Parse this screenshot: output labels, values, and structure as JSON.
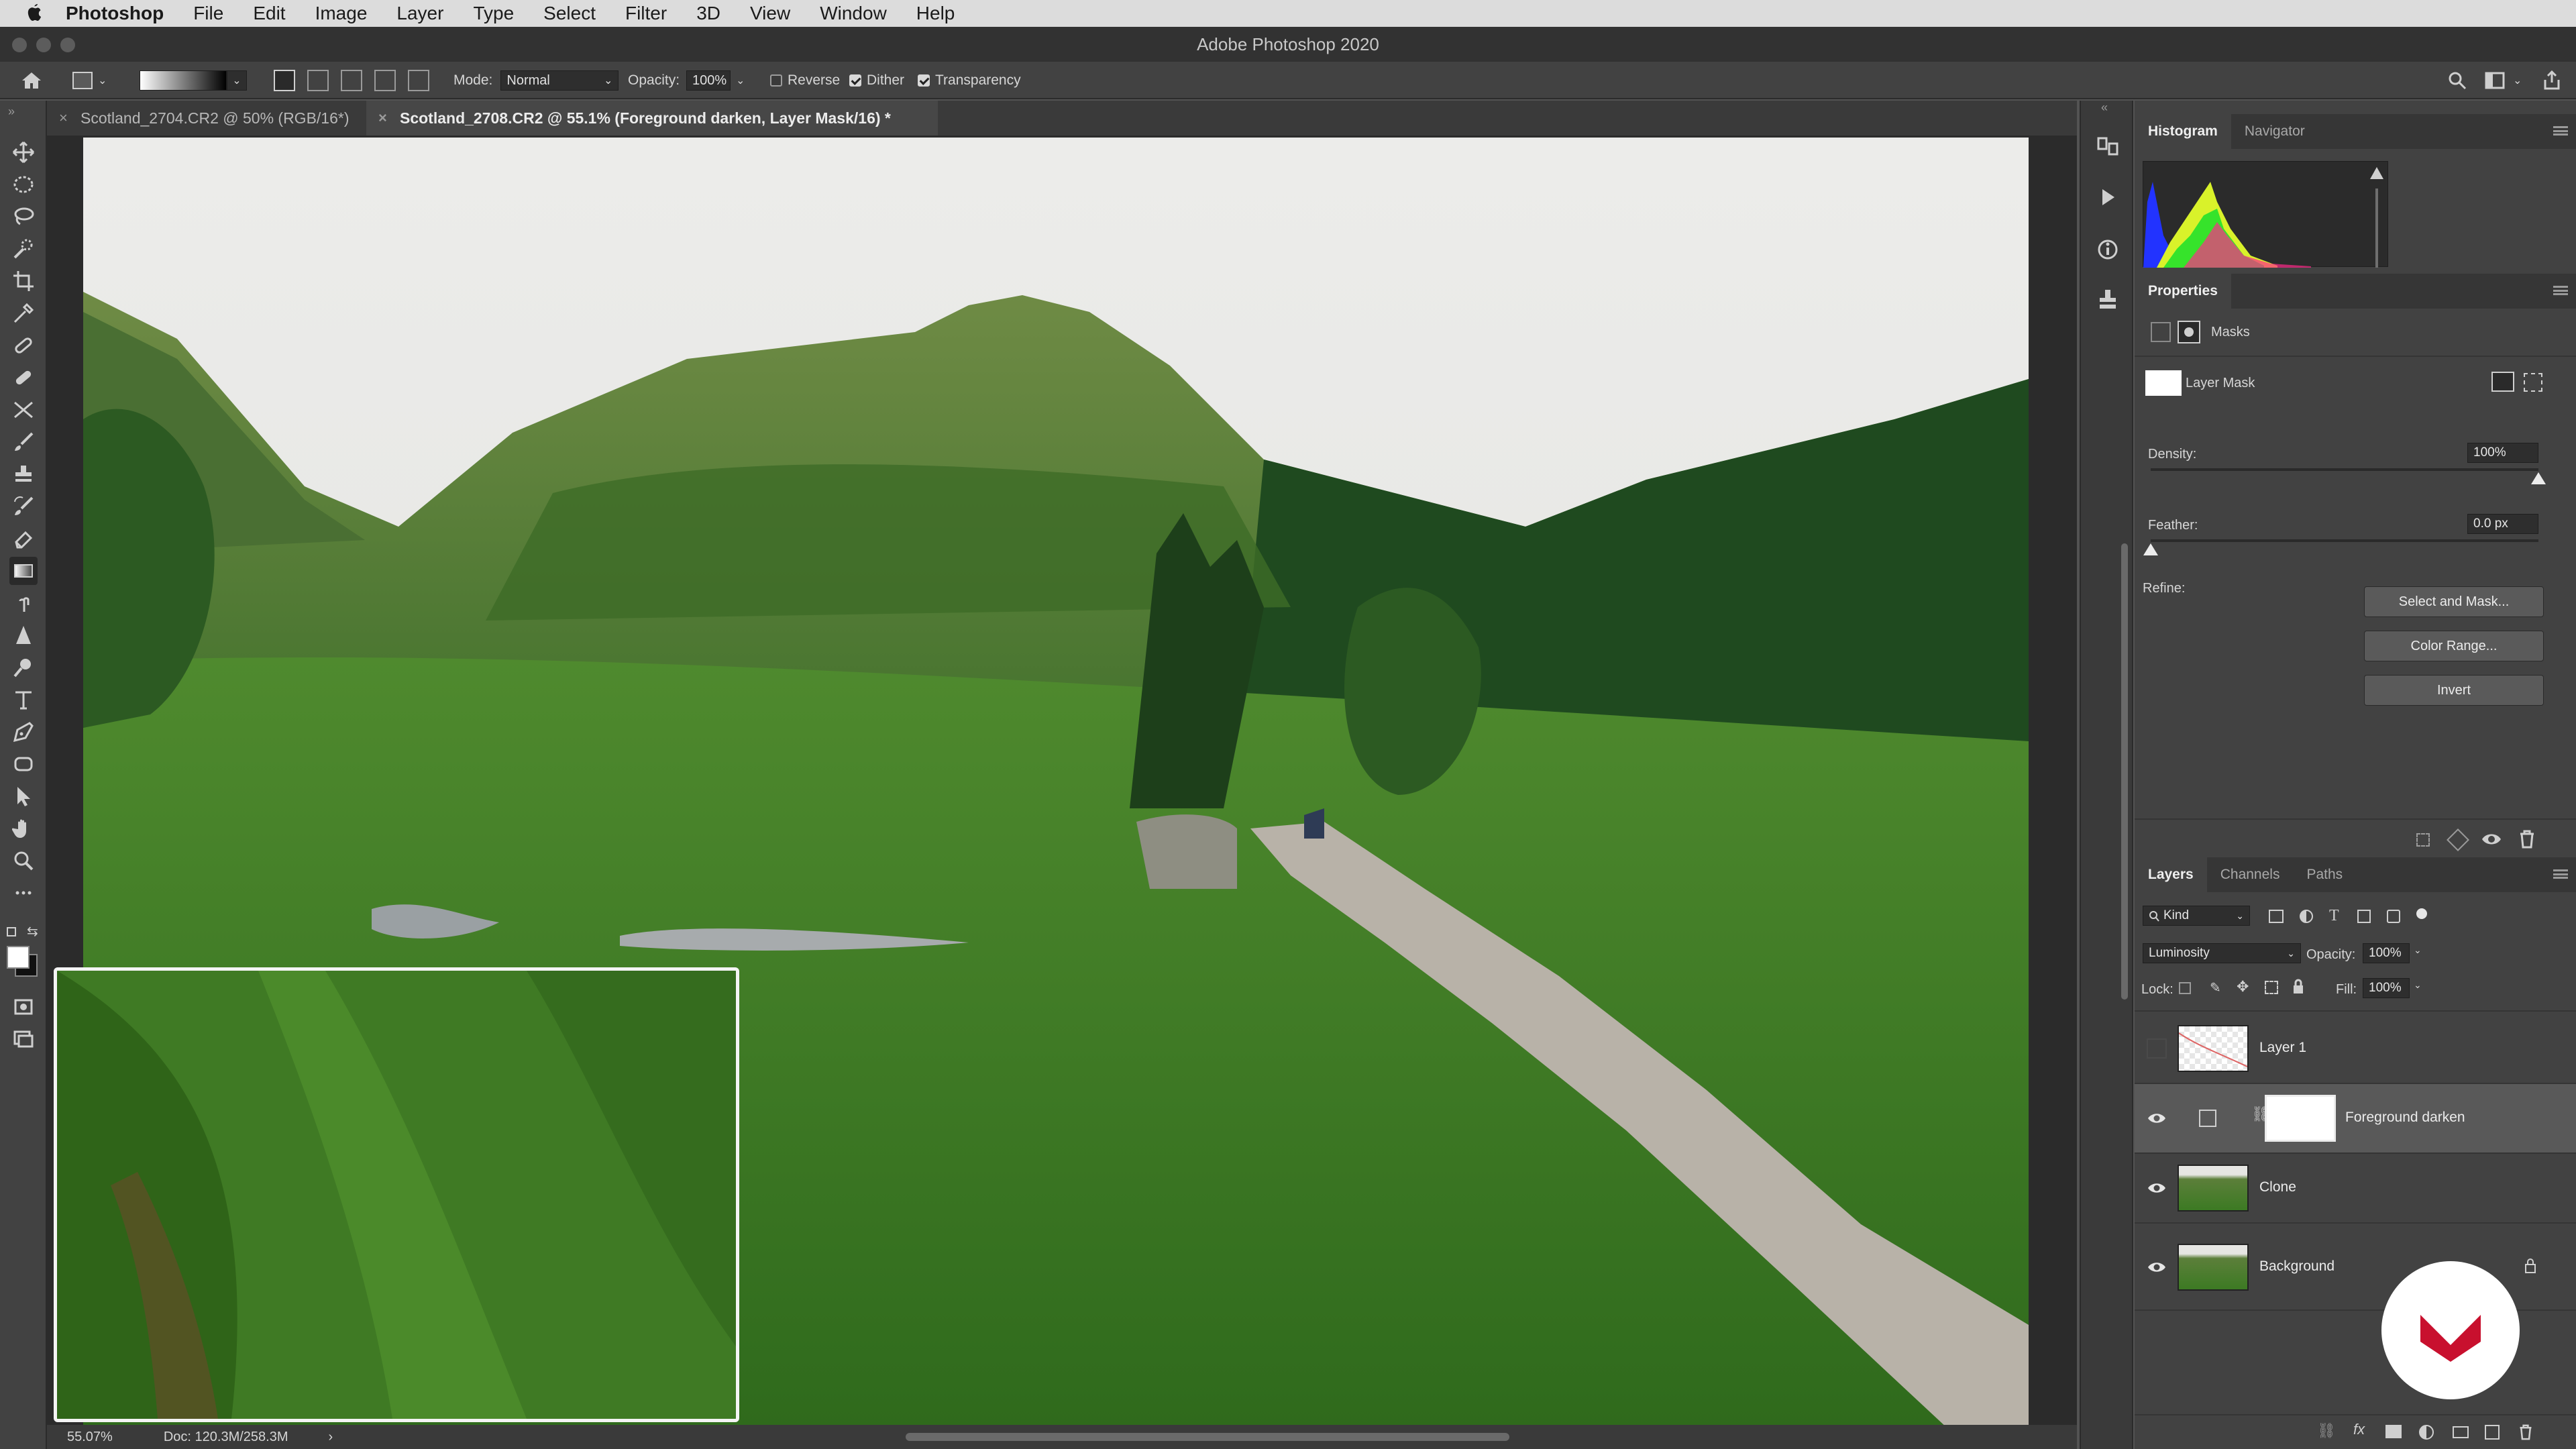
{
  "menubar": {
    "app_name": "Photoshop",
    "items": [
      "File",
      "Edit",
      "Image",
      "Layer",
      "Type",
      "Select",
      "Filter",
      "3D",
      "View",
      "Window",
      "Help"
    ]
  },
  "window": {
    "title": "Adobe Photoshop 2020"
  },
  "options": {
    "mode_label": "Mode:",
    "mode_value": "Normal",
    "opacity_label": "Opacity:",
    "opacity_value": "100%",
    "reverse_label": "Reverse",
    "reverse_checked": false,
    "dither_label": "Dither",
    "dither_checked": true,
    "transparency_label": "Transparency",
    "transparency_checked": true
  },
  "tabs": [
    {
      "label": "Scotland_2704.CR2 @ 50% (RGB/16*)",
      "active": false
    },
    {
      "label": "Scotland_2708.CR2 @ 55.1% (Foreground darken, Layer Mask/16) *",
      "active": true
    }
  ],
  "status": {
    "zoom": "55.07%",
    "doc": "Doc: 120.3M/258.3M",
    "arrow": "›"
  },
  "histogram_panel": {
    "tabs": [
      "Histogram",
      "Navigator"
    ],
    "active": "Histogram"
  },
  "properties": {
    "title": "Properties",
    "masks_label": "Masks",
    "layer_mask_label": "Layer Mask",
    "density_label": "Density:",
    "density_value": "100%",
    "density_level": 1.0,
    "feather_label": "Feather:",
    "feather_value": "0.0 px",
    "feather_level": 0.0,
    "refine_label": "Refine:",
    "buttons": [
      "Select and Mask...",
      "Color Range...",
      "Invert"
    ]
  },
  "layers_panel": {
    "tabs": [
      "Layers",
      "Channels",
      "Paths"
    ],
    "active": "Layers",
    "filter_kind": "Kind",
    "blend_mode": "Luminosity",
    "opacity_label": "Opacity:",
    "opacity_value": "100%",
    "lock_label": "Lock:",
    "fill_label": "Fill:",
    "fill_value": "100%",
    "layers": [
      {
        "name": "Layer 1",
        "visible": false,
        "selected": false
      },
      {
        "name": "Foreground darken",
        "visible": true,
        "selected": true
      },
      {
        "name": "Clone",
        "visible": true,
        "selected": false
      },
      {
        "name": "Background",
        "visible": true,
        "selected": false,
        "locked": true
      }
    ]
  },
  "colors": {
    "ui_bg": "#424242",
    "accent_logo": "#c8102e"
  }
}
